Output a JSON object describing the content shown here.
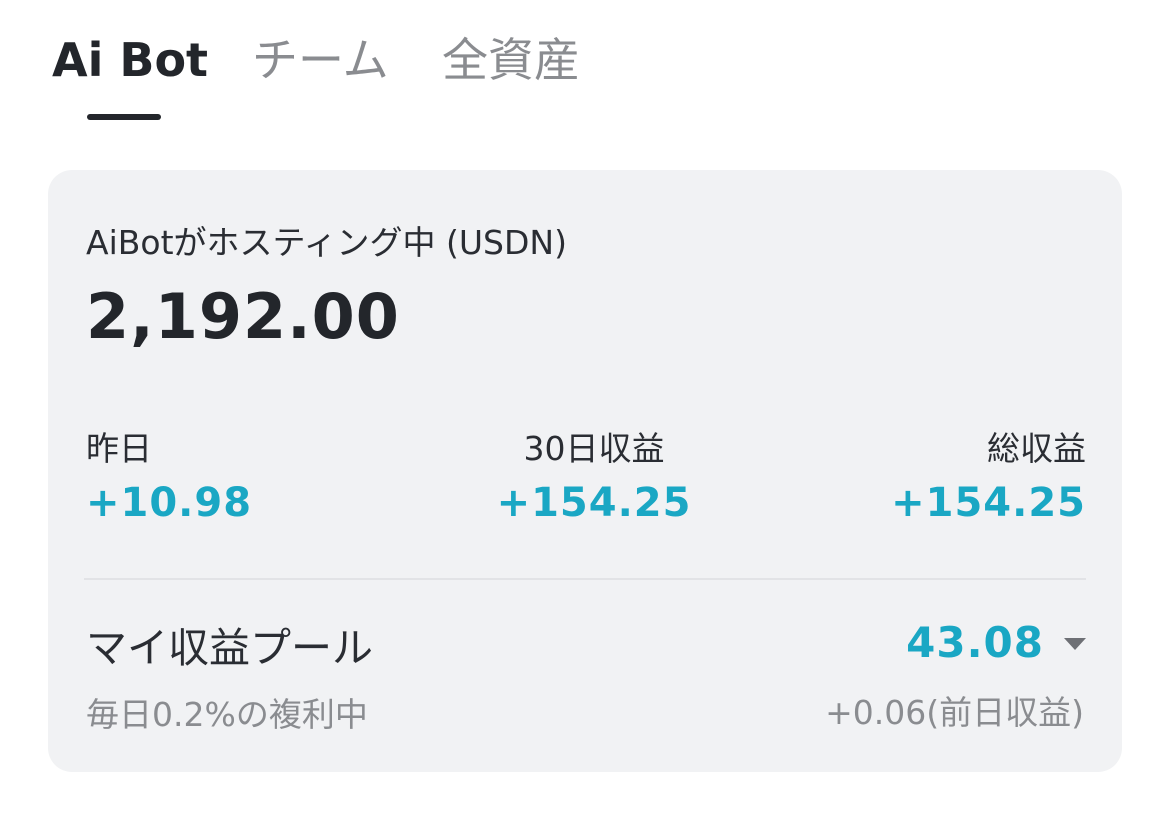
{
  "tabs": [
    {
      "label": "Ai Bot",
      "active": true
    },
    {
      "label": "チーム",
      "active": false
    },
    {
      "label": "全資産",
      "active": false
    }
  ],
  "hosting": {
    "label": "AiBotがホスティング中 (USDN)",
    "amount": "2,192.00"
  },
  "stats": [
    {
      "label": "昨日",
      "value": "+10.98"
    },
    {
      "label": "30日収益",
      "value": "+154.25"
    },
    {
      "label": "総収益",
      "value": "+154.25"
    }
  ],
  "pool": {
    "title": "マイ収益プール",
    "subtitle": "毎日0.2%の複利中",
    "value": "43.08",
    "yesterday": "+0.06(前日収益)",
    "expand_icon": "caret-down-icon"
  },
  "colors": {
    "accent": "#1aa7c4",
    "card_bg": "#f1f2f4",
    "text_primary": "#23262b",
    "text_secondary": "#8a8c90"
  }
}
